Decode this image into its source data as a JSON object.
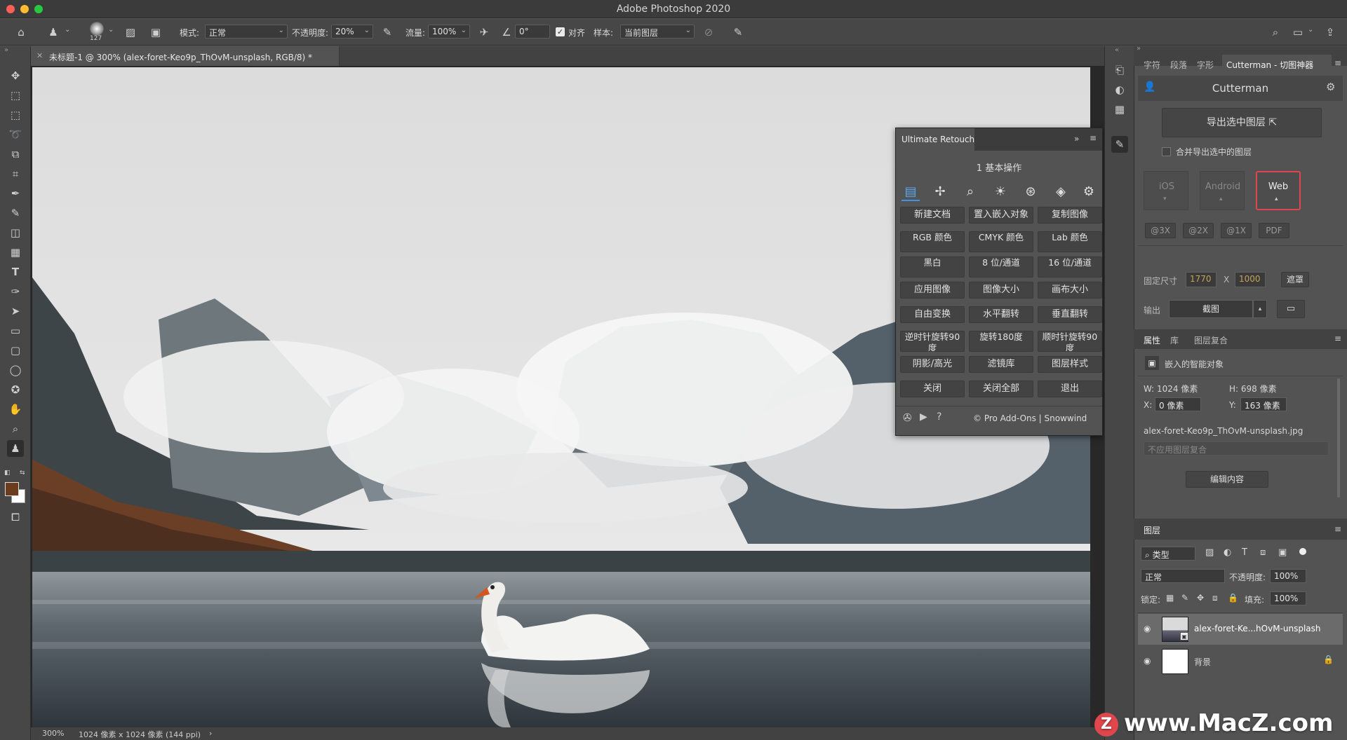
{
  "window": {
    "title": "Adobe Photoshop 2020"
  },
  "options_bar": {
    "brush_size": "127",
    "mode_label": "模式:",
    "mode_value": "正常",
    "opacity_label": "不透明度:",
    "opacity_value": "20%",
    "flow_label": "流量:",
    "flow_value": "100%",
    "angle_value": "0°",
    "aligned_label": "对齐",
    "sample_label": "样本:",
    "sample_value": "当前图层"
  },
  "document": {
    "tab_title": "未标题-1 @ 300% (alex-foret-Keo9p_ThOvM-unsplash, RGB/8) *",
    "zoom": "300%",
    "doc_info": "1024 像素 x 1024 像素 (144 ppi)"
  },
  "ultimate_retouch": {
    "title": "Ultimate Retouch",
    "section": "1 基本操作",
    "buttons": [
      [
        "新建文档",
        "置入嵌入对象",
        "复制图像"
      ],
      [
        "RGB 颜色",
        "CMYK 颜色",
        "Lab 颜色"
      ],
      [
        "黑白",
        "8 位/通道",
        "16 位/通道"
      ],
      [
        "应用图像",
        "图像大小",
        "画布大小"
      ],
      [
        "自由变换",
        "水平翻转",
        "垂直翻转"
      ],
      [
        "逆时针旋转90度",
        "旋转180度",
        "顺时针旋转90度"
      ],
      [
        "阴影/高光",
        "滤镜库",
        "图层样式"
      ],
      [
        "关闭",
        "关闭全部",
        "退出"
      ]
    ],
    "footer": "© Pro Add-Ons | Snowwind"
  },
  "cutterman": {
    "tabs": [
      "字符",
      "段落",
      "字形",
      "Cutterman - 切图神器"
    ],
    "header": "Cutterman",
    "export_button": "导出选中图层",
    "merge_label": "合并导出选中的图层",
    "platforms": [
      "iOS",
      "Android",
      "Web"
    ],
    "scales": [
      "@3X",
      "@2X",
      "@1X",
      "PDF"
    ],
    "fixed_size_label": "固定尺寸",
    "width": "1770",
    "height": "1000",
    "x_sep": "X",
    "mask_button": "遮罩",
    "output_label": "输出",
    "output_value": "截图"
  },
  "properties": {
    "tabs": [
      "属性",
      "库",
      "图层复合"
    ],
    "type_label": "嵌入的智能对象",
    "w": "W: 1024 像素",
    "h": "H: 698 像素",
    "x_label": "X:",
    "x_value": "0 像素",
    "y_label": "Y:",
    "y_value": "163 像素",
    "filename": "alex-foret-Keo9p_ThOvM-unsplash.jpg",
    "comp_placeholder": "不应用图层复合",
    "edit_button": "编辑内容"
  },
  "layers": {
    "tab": "图层",
    "filter_label": "类型",
    "blend_mode": "正常",
    "opacity_label": "不透明度:",
    "opacity_value": "100%",
    "lock_label": "锁定:",
    "fill_label": "填充:",
    "fill_value": "100%",
    "items": [
      {
        "name": "alex-foret-Ke...hOvM-unsplash"
      },
      {
        "name": "背景"
      }
    ]
  },
  "watermark": "www.MacZ.com",
  "colors": {
    "accent": "#e0474c",
    "foreground": "#6b3d1e",
    "background": "#ffffff"
  }
}
